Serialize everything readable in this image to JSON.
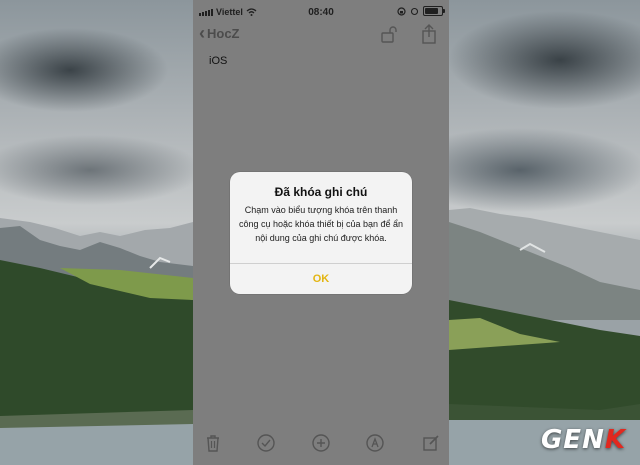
{
  "status_bar": {
    "carrier": "Viettel",
    "time": "08:40"
  },
  "navbar": {
    "back_label": "HocZ"
  },
  "note": {
    "content": "iOS"
  },
  "alert": {
    "title": "Đã khóa ghi chú",
    "message": "Chạm vào biểu tượng khóa trên thanh công cụ hoặc khóa thiết bị của bạn để ẩn nội dung của ghi chú được khóa.",
    "ok_label": "OK"
  },
  "toolbar": {
    "icons": [
      "trash-icon",
      "checkmark-icon",
      "plus-icon",
      "pen-icon",
      "compose-icon"
    ]
  },
  "watermark": {
    "prefix": "GEN",
    "suffix": "K"
  },
  "colors": {
    "accent": "#e3b512",
    "dimmed_screen": "#7e7e7e",
    "alert_bg": "#f3f3f3"
  }
}
